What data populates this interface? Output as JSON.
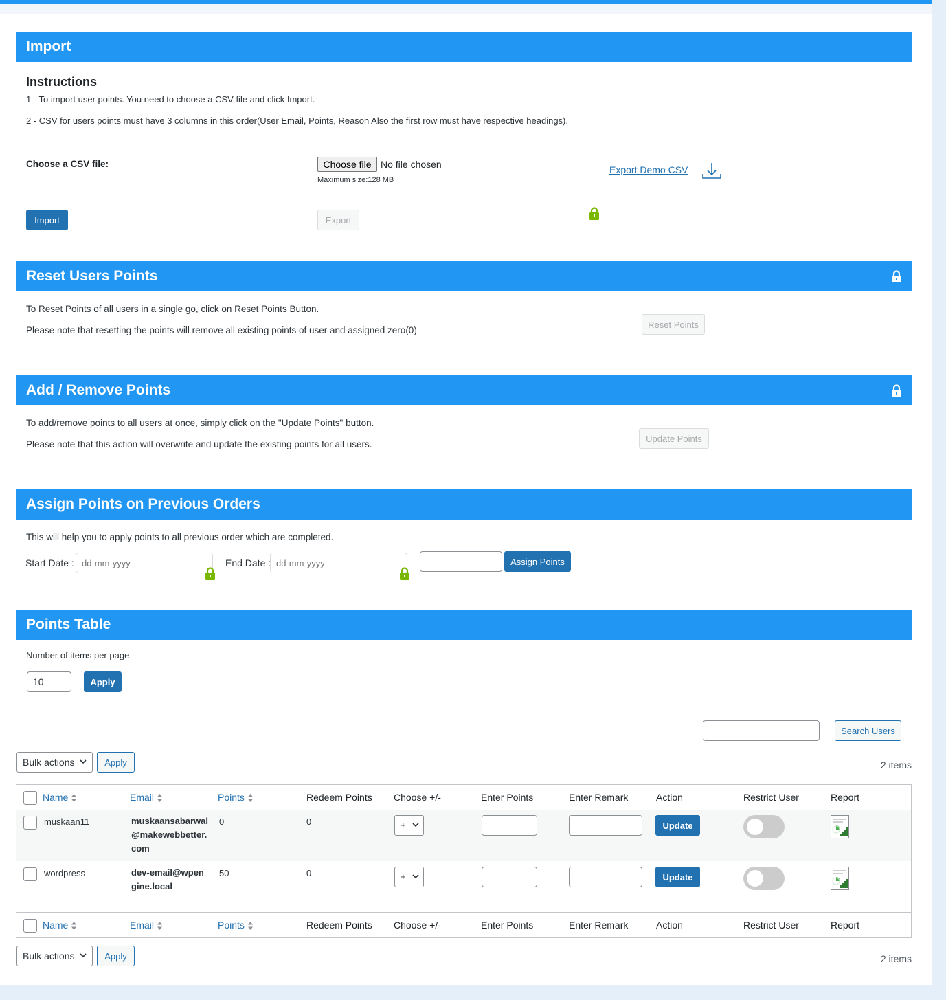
{
  "colors": {
    "header": "#2196f3",
    "primary_button": "#2271b1",
    "lock": "#7ab800"
  },
  "import": {
    "title": "Import",
    "instructions_title": "Instructions",
    "line1": "1 - To import user points. You need to choose a CSV file and click Import.",
    "line2": "2 - CSV for users points must have 3 columns in this order(User Email, Points, Reason Also the first row must have respective headings).",
    "csv_label": "Choose a CSV file:",
    "choose_file": "Choose file",
    "no_file": "No file chosen",
    "max_size": "Maximum size:128 MB",
    "export_demo": "Export Demo CSV",
    "import_button": "Import",
    "export_button": "Export"
  },
  "reset": {
    "title": "Reset Users Points",
    "line1": "To Reset Points of all users in a single go, click on Reset Points Button.",
    "line2": "Please note that resetting the points will remove all existing points of user and assigned zero(0)",
    "button": "Reset Points"
  },
  "add_remove": {
    "title": "Add / Remove Points",
    "line1": "To add/remove points to all users at once, simply click on the \"Update Points\" button.",
    "line2": "Please note that this action will overwrite and update the existing points for all users.",
    "button": "Update Points"
  },
  "previous_orders": {
    "title": "Assign Points on Previous Orders",
    "description": "This will help you to apply points to all previous order which are completed.",
    "start_label": "Start Date :",
    "end_label": "End Date :",
    "date_placeholder": "dd-mm-yyyy",
    "button": "Assign Points"
  },
  "points_table": {
    "title": "Points Table",
    "per_page_label": "Number of items per page",
    "per_page_value": "10",
    "apply": "Apply",
    "search_button": "Search Users",
    "bulk_actions": "Bulk actions",
    "bulk_apply": "Apply",
    "items_count": "2 items",
    "columns": [
      "Name",
      "Email",
      "Points",
      "Redeem Points",
      "Choose +/-",
      "Enter Points",
      "Enter Remark",
      "Action",
      "Restrict User",
      "Report"
    ],
    "rows": [
      {
        "name": "muskaan11",
        "email": "muskaansabarwal@makewebbetter.com",
        "points": "0",
        "redeem": "0",
        "choose": "+",
        "action": "Update",
        "restricted": false
      },
      {
        "name": "wordpress",
        "email": "dev-email@wpengine.local",
        "points": "50",
        "redeem": "0",
        "choose": "+",
        "action": "Update",
        "restricted": false
      }
    ]
  }
}
